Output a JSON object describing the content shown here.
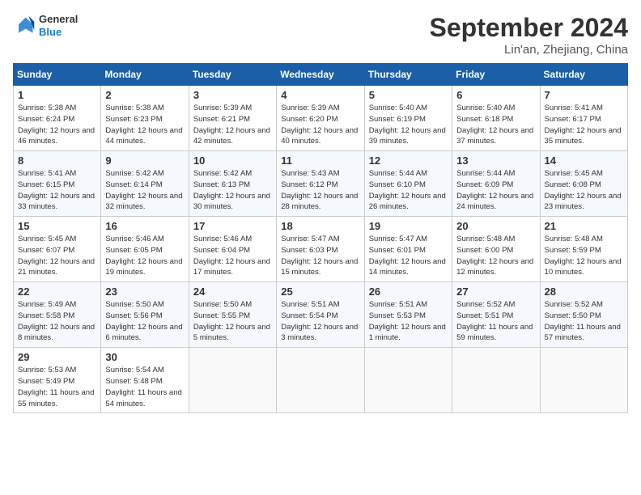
{
  "header": {
    "logo_line1": "General",
    "logo_line2": "Blue",
    "month": "September 2024",
    "location": "Lin'an, Zhejiang, China"
  },
  "weekdays": [
    "Sunday",
    "Monday",
    "Tuesday",
    "Wednesday",
    "Thursday",
    "Friday",
    "Saturday"
  ],
  "weeks": [
    [
      {
        "day": "1",
        "info": "Sunrise: 5:38 AM\nSunset: 6:24 PM\nDaylight: 12 hours and 46 minutes."
      },
      {
        "day": "2",
        "info": "Sunrise: 5:38 AM\nSunset: 6:23 PM\nDaylight: 12 hours and 44 minutes."
      },
      {
        "day": "3",
        "info": "Sunrise: 5:39 AM\nSunset: 6:21 PM\nDaylight: 12 hours and 42 minutes."
      },
      {
        "day": "4",
        "info": "Sunrise: 5:39 AM\nSunset: 6:20 PM\nDaylight: 12 hours and 40 minutes."
      },
      {
        "day": "5",
        "info": "Sunrise: 5:40 AM\nSunset: 6:19 PM\nDaylight: 12 hours and 39 minutes."
      },
      {
        "day": "6",
        "info": "Sunrise: 5:40 AM\nSunset: 6:18 PM\nDaylight: 12 hours and 37 minutes."
      },
      {
        "day": "7",
        "info": "Sunrise: 5:41 AM\nSunset: 6:17 PM\nDaylight: 12 hours and 35 minutes."
      }
    ],
    [
      {
        "day": "8",
        "info": "Sunrise: 5:41 AM\nSunset: 6:15 PM\nDaylight: 12 hours and 33 minutes."
      },
      {
        "day": "9",
        "info": "Sunrise: 5:42 AM\nSunset: 6:14 PM\nDaylight: 12 hours and 32 minutes."
      },
      {
        "day": "10",
        "info": "Sunrise: 5:42 AM\nSunset: 6:13 PM\nDaylight: 12 hours and 30 minutes."
      },
      {
        "day": "11",
        "info": "Sunrise: 5:43 AM\nSunset: 6:12 PM\nDaylight: 12 hours and 28 minutes."
      },
      {
        "day": "12",
        "info": "Sunrise: 5:44 AM\nSunset: 6:10 PM\nDaylight: 12 hours and 26 minutes."
      },
      {
        "day": "13",
        "info": "Sunrise: 5:44 AM\nSunset: 6:09 PM\nDaylight: 12 hours and 24 minutes."
      },
      {
        "day": "14",
        "info": "Sunrise: 5:45 AM\nSunset: 6:08 PM\nDaylight: 12 hours and 23 minutes."
      }
    ],
    [
      {
        "day": "15",
        "info": "Sunrise: 5:45 AM\nSunset: 6:07 PM\nDaylight: 12 hours and 21 minutes."
      },
      {
        "day": "16",
        "info": "Sunrise: 5:46 AM\nSunset: 6:05 PM\nDaylight: 12 hours and 19 minutes."
      },
      {
        "day": "17",
        "info": "Sunrise: 5:46 AM\nSunset: 6:04 PM\nDaylight: 12 hours and 17 minutes."
      },
      {
        "day": "18",
        "info": "Sunrise: 5:47 AM\nSunset: 6:03 PM\nDaylight: 12 hours and 15 minutes."
      },
      {
        "day": "19",
        "info": "Sunrise: 5:47 AM\nSunset: 6:01 PM\nDaylight: 12 hours and 14 minutes."
      },
      {
        "day": "20",
        "info": "Sunrise: 5:48 AM\nSunset: 6:00 PM\nDaylight: 12 hours and 12 minutes."
      },
      {
        "day": "21",
        "info": "Sunrise: 5:48 AM\nSunset: 5:59 PM\nDaylight: 12 hours and 10 minutes."
      }
    ],
    [
      {
        "day": "22",
        "info": "Sunrise: 5:49 AM\nSunset: 5:58 PM\nDaylight: 12 hours and 8 minutes."
      },
      {
        "day": "23",
        "info": "Sunrise: 5:50 AM\nSunset: 5:56 PM\nDaylight: 12 hours and 6 minutes."
      },
      {
        "day": "24",
        "info": "Sunrise: 5:50 AM\nSunset: 5:55 PM\nDaylight: 12 hours and 5 minutes."
      },
      {
        "day": "25",
        "info": "Sunrise: 5:51 AM\nSunset: 5:54 PM\nDaylight: 12 hours and 3 minutes."
      },
      {
        "day": "26",
        "info": "Sunrise: 5:51 AM\nSunset: 5:53 PM\nDaylight: 12 hours and 1 minute."
      },
      {
        "day": "27",
        "info": "Sunrise: 5:52 AM\nSunset: 5:51 PM\nDaylight: 11 hours and 59 minutes."
      },
      {
        "day": "28",
        "info": "Sunrise: 5:52 AM\nSunset: 5:50 PM\nDaylight: 11 hours and 57 minutes."
      }
    ],
    [
      {
        "day": "29",
        "info": "Sunrise: 5:53 AM\nSunset: 5:49 PM\nDaylight: 11 hours and 55 minutes."
      },
      {
        "day": "30",
        "info": "Sunrise: 5:54 AM\nSunset: 5:48 PM\nDaylight: 11 hours and 54 minutes."
      },
      {
        "day": "",
        "info": ""
      },
      {
        "day": "",
        "info": ""
      },
      {
        "day": "",
        "info": ""
      },
      {
        "day": "",
        "info": ""
      },
      {
        "day": "",
        "info": ""
      }
    ]
  ]
}
